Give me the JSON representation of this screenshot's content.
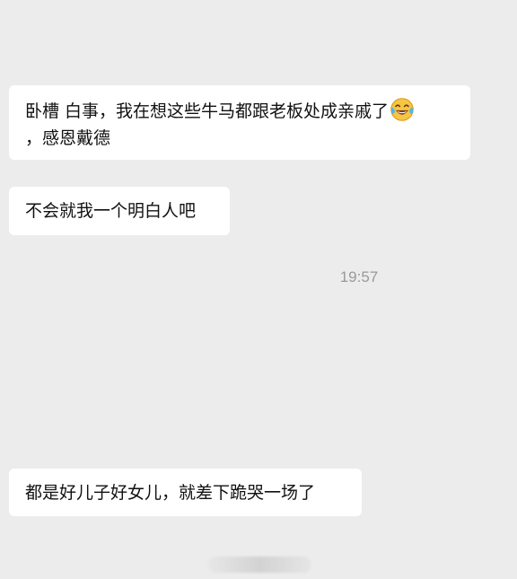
{
  "chat": {
    "messages": [
      {
        "line1": "卧槽 白事，我在想这些牛马都跟老板处成亲戚了",
        "emoji": "laughing-tears-emoji",
        "line2": "，感恩戴德"
      },
      {
        "line1": "不会就我一个明白人吧"
      },
      {
        "line1": "都是好儿子好女儿，就差下跪哭一场了"
      }
    ],
    "timestamp": "19:57"
  },
  "colors": {
    "background": "#ececec",
    "bubble": "#ffffff",
    "text": "#111111",
    "timestamp": "#9a9a9a",
    "emoji_face": "#f6c643"
  }
}
